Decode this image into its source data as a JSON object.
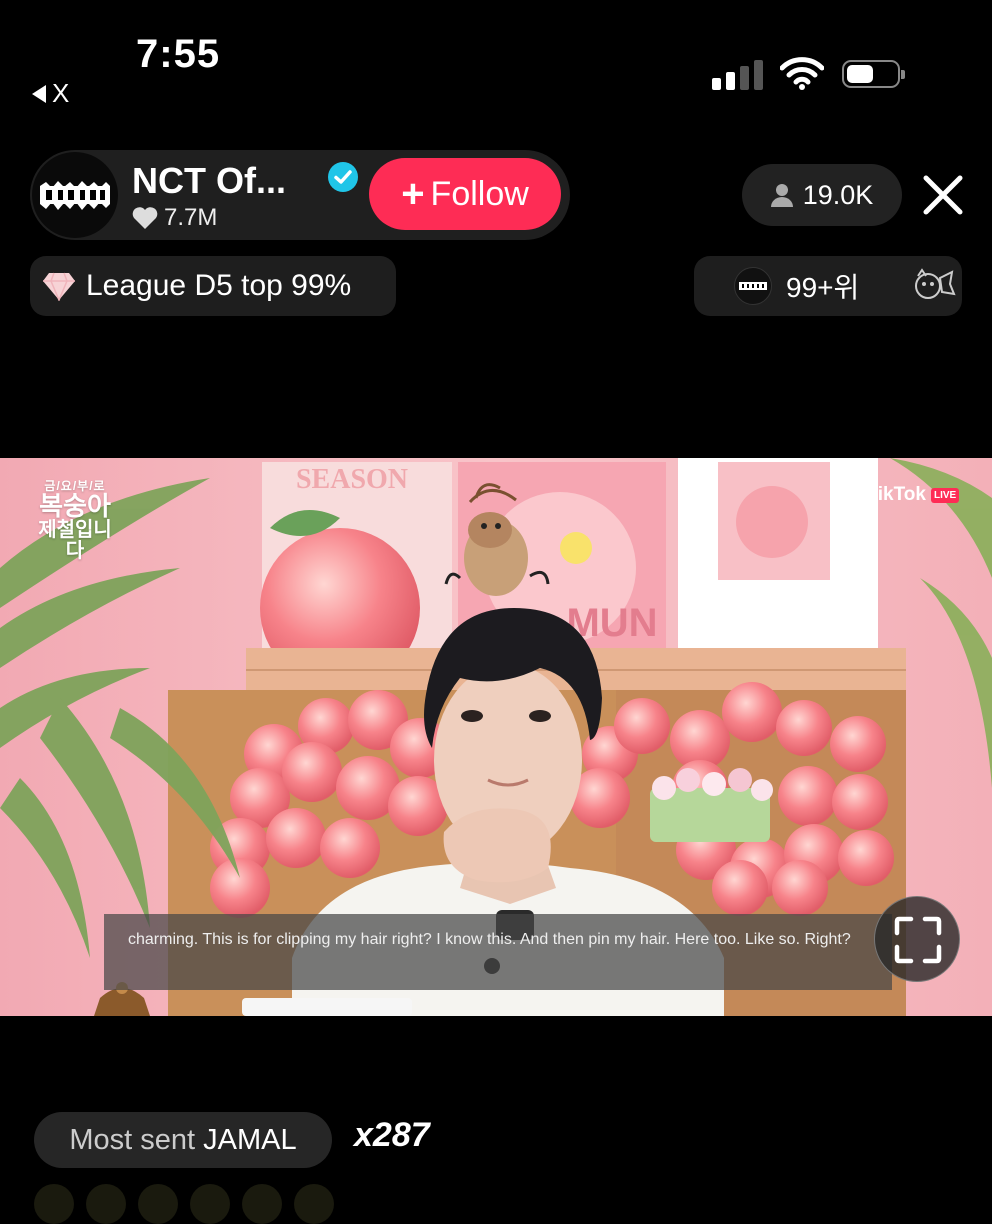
{
  "status_bar": {
    "time": "7:55",
    "back_label": "X",
    "battery_level": 0.55
  },
  "host": {
    "name": "NCT Of...",
    "likes": "7.7M",
    "follow_label": "Follow",
    "viewers": "19.0K"
  },
  "league": {
    "label": "League D5 top 99%"
  },
  "rank": {
    "label": "99+위"
  },
  "video": {
    "title_top": "금/요/부/로",
    "title_main": "복숭아",
    "title_sub": "제철입니다",
    "tiktok_label": "TikTok",
    "live_label": "LIVE",
    "caption": "charming. This is for clipping my hair right? I know this. And then pin my hair. Here too. Like so. Right?",
    "poster_word_1": "SEASON",
    "poster_word_2": "MUN"
  },
  "gift": {
    "prefix": "Most sent",
    "name": "JAMAL",
    "count": "x287"
  },
  "colors": {
    "follow": "#fe2c55",
    "verified": "#20c5e8",
    "background": "#000000"
  }
}
